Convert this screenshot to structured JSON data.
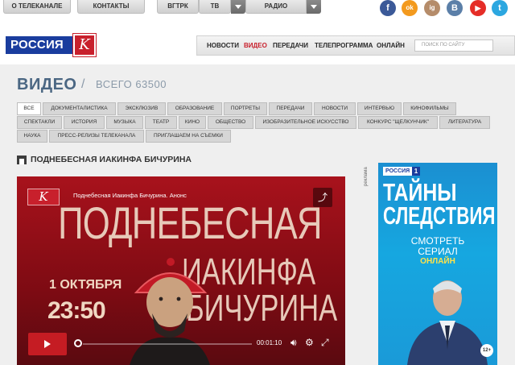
{
  "topbar": {
    "about": "О ТЕЛЕКАНАЛЕ",
    "contacts": "КОНТАКТЫ",
    "vgtrk": "ВГТРК",
    "tv": "ТВ",
    "radio": "РАДИО"
  },
  "social": {
    "facebook": "f",
    "odnoklassniki": "ok",
    "instagram": "ig",
    "vkontakte": "В",
    "youtube": "▶",
    "twitter": "t"
  },
  "logo": {
    "text": "РОССИЯ",
    "k": "K"
  },
  "nav": {
    "items": [
      "НОВОСТИ",
      "ВИДЕО",
      "ПЕРЕДАЧИ",
      "ТЕЛЕПРОГРАММА",
      "ОНЛАЙН"
    ],
    "active": "ВИДЕО",
    "search_placeholder": "ПОИСК ПО САЙТУ"
  },
  "page": {
    "title": "ВИДЕО",
    "separator": "/",
    "total": "ВСЕГО 63500"
  },
  "tabs": [
    "ВСЕ",
    "ДОКУМЕНТАЛИСТИКА",
    "ЭКСКЛЮЗИВ",
    "ОБРАЗОВАНИЕ",
    "ПОРТРЕТЫ",
    "ПЕРЕДАЧИ",
    "НОВОСТИ",
    "ИНТЕРВЬЮ",
    "КИНОФИЛЬМЫ",
    "СПЕКТАКЛИ",
    "ИСТОРИЯ",
    "МУЗЫКА",
    "ТЕАТР",
    "КИНО",
    "ОБЩЕСТВО",
    "ИЗОБРАЗИТЕЛЬНОЕ ИСКУССТВО",
    "КОНКУРС \"ЩЕЛКУНЧИК\"",
    "ЛИТЕРАТУРА",
    "НАУКА",
    "ПРЕСС-РЕЛИЗЫ ТЕЛЕКАНАЛА",
    "ПРИГЛАШАЕМ НА СЪЕМКИ"
  ],
  "active_tab": "ВСЕ",
  "section_title": "ПОДНЕБЕСНАЯ ИАКИНФА БИЧУРИНА",
  "player": {
    "caption": "Поднебесная Иакинфа Бичурина. Анонс",
    "big_line1": "ПОДНЕБЕСНАЯ",
    "big_line2": "ИАКИНФА",
    "big_line3": "БИЧУРИНА",
    "date_line1": "1 ОКТЯБРЯ",
    "date_line2": "23:50",
    "time": "00:01:10",
    "progress_fraction": 0.0
  },
  "ad": {
    "label": "реклама",
    "brand": "РОССИЯ",
    "brand_num": "1",
    "title_line1": "ТАЙНЫ",
    "title_line2": "СЛЕДСТВИЯ",
    "sub1": "СМОТРЕТЬ",
    "sub2": "СЕРИАЛ",
    "sub3": "ОНЛАЙН",
    "age": "12+"
  },
  "colors": {
    "brand_blue": "#1a3d9e",
    "brand_red": "#c8202c",
    "title_slate": "#4b6783",
    "ad_blue": "#16a7e0",
    "ad_yellow": "#ffe24a"
  }
}
